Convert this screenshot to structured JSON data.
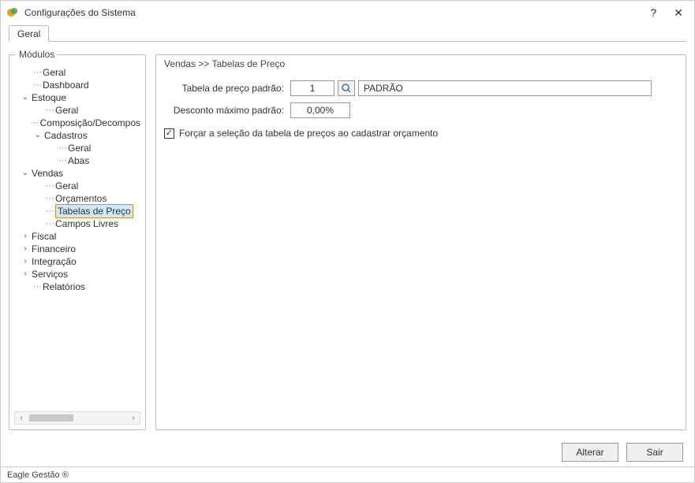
{
  "window": {
    "title": "Configurações do Sistema",
    "help_label": "?",
    "close_label": "✕"
  },
  "tabs": {
    "main": "Geral"
  },
  "modules": {
    "legend": "Módulos",
    "items": {
      "geral": "Geral",
      "dashboard": "Dashboard",
      "estoque": "Estoque",
      "estoque_geral": "Geral",
      "estoque_composicao": "Composição/Decompos",
      "cadastros": "Cadastros",
      "cadastros_geral": "Geral",
      "cadastros_abas": "Abas",
      "vendas": "Vendas",
      "vendas_geral": "Geral",
      "vendas_orcamentos": "Orçamentos",
      "vendas_tabelas": "Tabelas de Preço",
      "vendas_campos": "Campos Livres",
      "fiscal": "Fiscal",
      "financeiro": "Financeiro",
      "integracao": "Integração",
      "servicos": "Serviços",
      "relatorios": "Relatórios"
    }
  },
  "breadcrumb": "Vendas  >>  Tabelas de Preço",
  "form": {
    "tabela_label": "Tabela de preço padrão:",
    "tabela_id": "1",
    "tabela_nome": "PADRÃO",
    "desconto_label": "Desconto máximo padrão:",
    "desconto_valor": "0,00%",
    "forcar_label": "Forçar a seleção da tabela de preços ao cadastrar orçamento",
    "forcar_checked": true
  },
  "buttons": {
    "alterar": "Alterar",
    "sair": "Sair"
  },
  "status": "Eagle Gestão ®"
}
